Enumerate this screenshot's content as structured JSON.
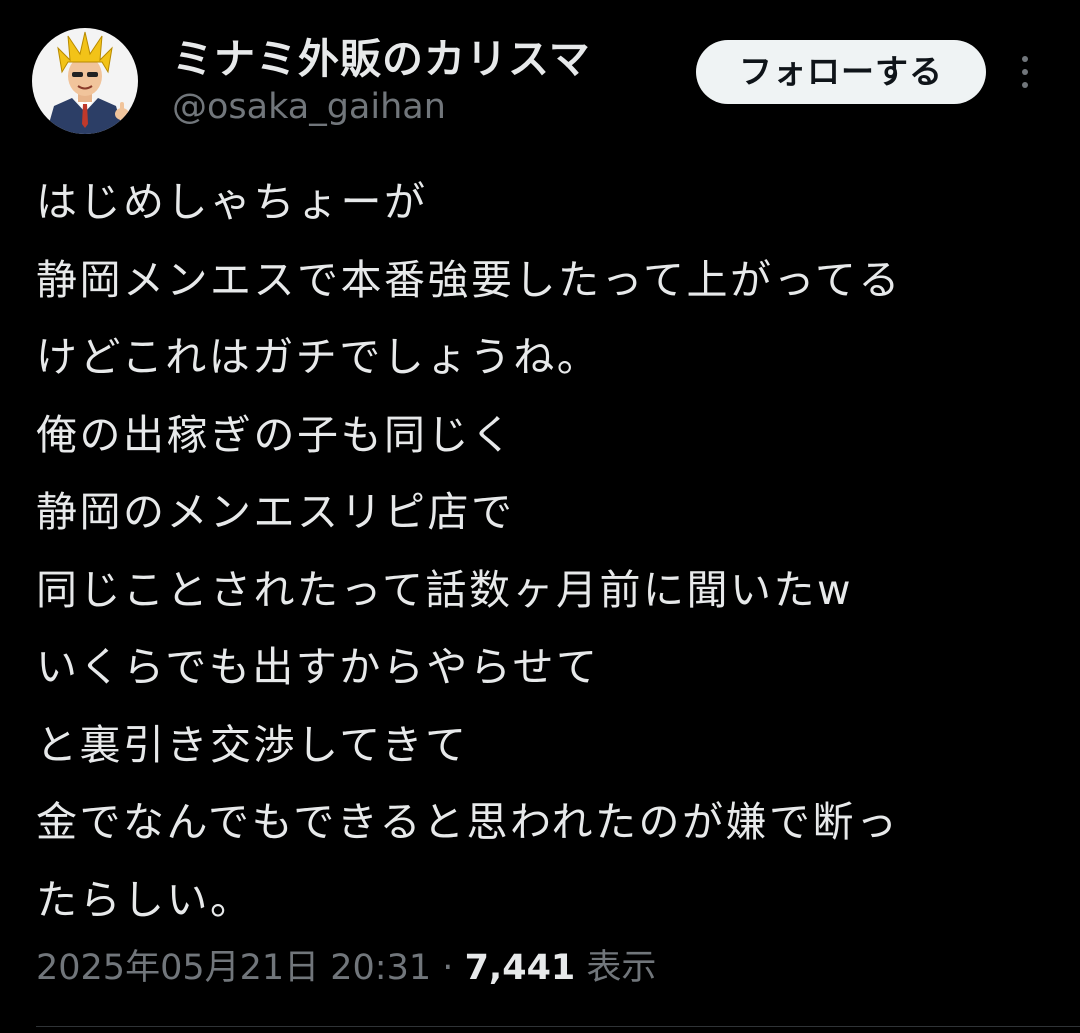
{
  "author": {
    "display_name": "ミナミ外販のカリスマ",
    "handle": "@osaka_gaihan",
    "avatar_icon": "avatar-cartoon-blond-man-in-suit"
  },
  "actions": {
    "follow_label": "フォローする",
    "more_icon": "more-vertical-icon"
  },
  "tweet": {
    "lines": [
      "はじめしゃちょーが",
      "静岡メンエスで本番強要したって上がってる",
      "けどこれはガチでしょうね。",
      "俺の出稼ぎの子も同じく",
      "静岡のメンエスリピ店で",
      "同じことされたって話数ヶ月前に聞いたw",
      "いくらでも出すからやらせて",
      "と裏引き交渉してきて",
      "金でなんでもできると思われたのが嫌で断っ",
      "たらしい。"
    ]
  },
  "meta": {
    "timestamp": "2025年05月21日 20:31",
    "separator": "·",
    "views_count": "7,441",
    "views_label": "表示"
  },
  "colors": {
    "background": "#000000",
    "text_primary": "#e7e9ea",
    "text_secondary": "#71767b",
    "follow_button_bg": "#eff3f4",
    "follow_button_text": "#0f1419",
    "divider": "#2f3336"
  }
}
